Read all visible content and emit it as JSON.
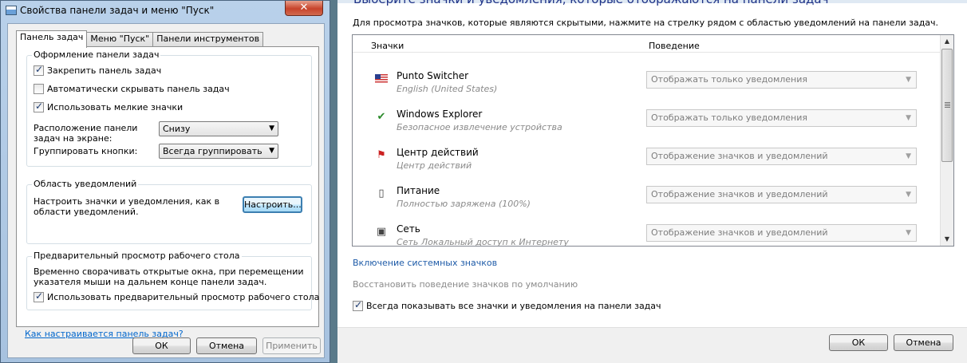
{
  "left_dialog": {
    "title": "Свойства панели задач и меню \"Пуск\"",
    "close_label": "✕",
    "tabs": [
      "Панель задач",
      "Меню \"Пуск\"",
      "Панели инструментов"
    ],
    "group_design": {
      "legend": "Оформление панели задач",
      "lock_label": "Закрепить панель задач",
      "lock_checked": true,
      "autohide_label": "Автоматически скрывать панель задач",
      "autohide_checked": false,
      "small_icons_label": "Использовать мелкие значки",
      "small_icons_checked": true,
      "location_label": "Расположение панели задач на экране:",
      "location_value": "Снизу",
      "buttons_label": "Группировать кнопки:",
      "buttons_value": "Всегда группировать"
    },
    "group_notify": {
      "legend": "Область уведомлений",
      "text": "Настроить значки и уведомления, как в области уведомлений.",
      "customize_button": "Настроить..."
    },
    "group_preview": {
      "legend": "Предварительный просмотр рабочего стола",
      "text": "Временно сворачивать открытые окна, при перемещении указателя мыши на дальнем конце панели задач.",
      "checkbox_label": "Использовать предварительный просмотр рабочего стола",
      "checkbox_checked": true
    },
    "help_link": "Как настраивается панель задач?",
    "ok_button": "ОК",
    "cancel_button": "Отмена",
    "apply_button": "Применить"
  },
  "right_window": {
    "title_clipped": "Выберите значки и уведомления, которые отображаются на панели задач",
    "info": "Для просмотра значков, которые являются скрытыми, нажмите на стрелку рядом с областью уведомлений на панели задач.",
    "col_icons": "Значки",
    "col_behavior": "Поведение",
    "items": [
      {
        "name": "Punto Switcher",
        "desc": "English (United States)",
        "behavior": "Отображать только уведомления",
        "icon": "us-flag-icon"
      },
      {
        "name": "Windows Explorer",
        "desc": "Безопасное извлечение устройства",
        "behavior": "Отображать только уведомления",
        "icon": "safely-remove-icon"
      },
      {
        "name": "Центр действий",
        "desc": "Центр действий",
        "behavior": "Отображение значков и уведомлений",
        "icon": "action-center-icon"
      },
      {
        "name": "Питание",
        "desc": "Полностью заряжена (100%)",
        "behavior": "Отображение значков и уведомлений",
        "icon": "power-icon"
      },
      {
        "name": "Сеть",
        "desc": "Сеть Локальный доступ к Интернету",
        "behavior": "Отображение значков и уведомлений",
        "icon": "network-icon"
      }
    ],
    "system_icons_link": "Включение системных значков",
    "restore_link": "Восстановить поведение значков по умолчанию",
    "always_show_label": "Всегда показывать все значки и уведомления на панели задач",
    "always_show_checked": true,
    "ok_button": "ОК",
    "cancel_button": "Отмена"
  }
}
